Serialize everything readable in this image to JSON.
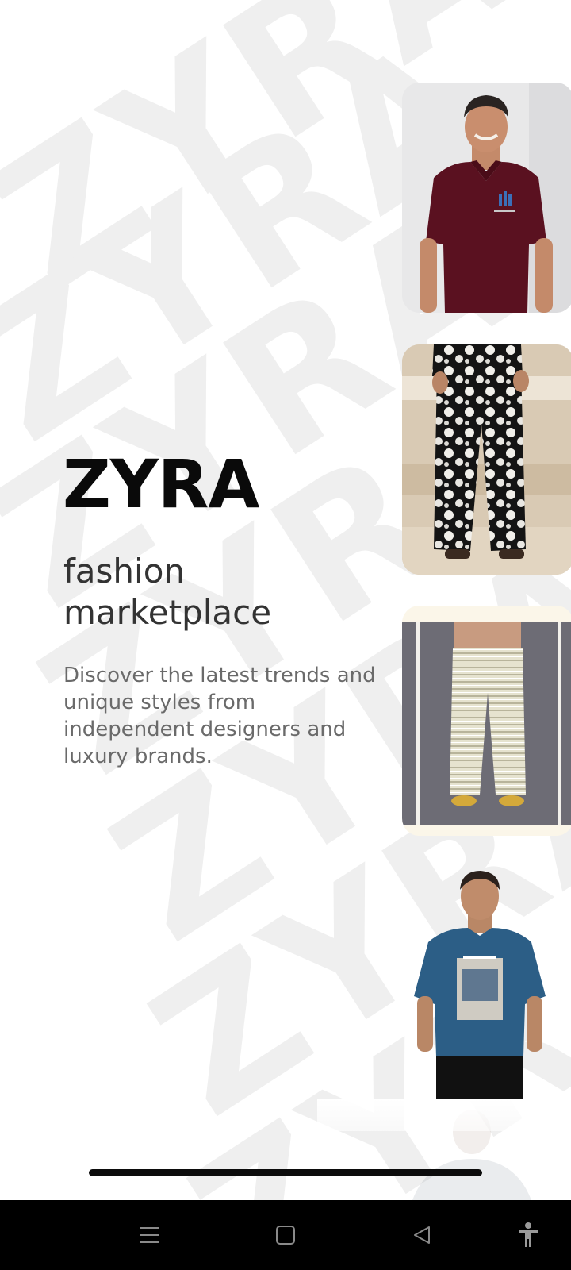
{
  "splash": {
    "watermark_text": "ZYRA",
    "brand": "ZYRA",
    "tagline": "fashion marketplace",
    "description": "Discover the latest trends and unique styles from independent designers and luxury brands."
  },
  "products": [
    {
      "name": "maroon-polo-shirt",
      "kind": "image"
    },
    {
      "name": "floral-printed-pants",
      "kind": "image"
    },
    {
      "name": "striped-cropped-pants",
      "kind": "image"
    },
    {
      "name": "blue-graphic-tshirt",
      "kind": "image"
    },
    {
      "name": "faded-product-preview",
      "kind": "image"
    }
  ],
  "navbar": {
    "icons": [
      "menu-icon",
      "home-square-icon",
      "back-triangle-icon",
      "accessibility-icon"
    ]
  },
  "colors": {
    "background": "#ffffff",
    "brand_text": "#0a0a0a",
    "tagline_text": "#333333",
    "description_text": "#6a6a6a",
    "watermark": "#efefef",
    "navbar": "#000000"
  }
}
